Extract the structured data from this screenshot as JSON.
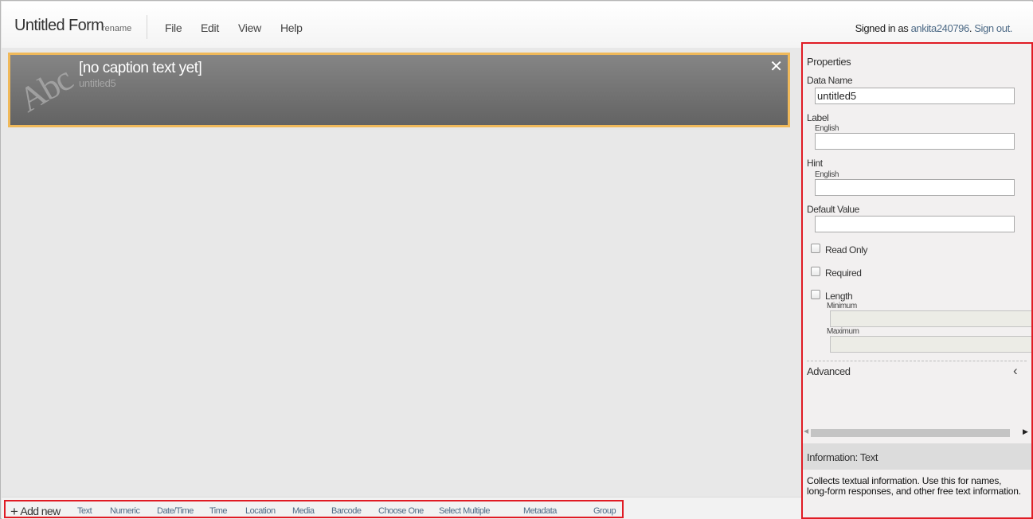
{
  "header": {
    "form_title": "Untitled Form",
    "rename_label": "rename",
    "menu": [
      "File",
      "Edit",
      "View",
      "Help"
    ],
    "signin_prefix": "Signed in as",
    "username": "ankita240796",
    "signout_label": "Sign out."
  },
  "workspace": {
    "control": {
      "caption": "[no caption text yet]",
      "data_name": "untitled5",
      "close_glyph": "✕",
      "icon_text": "Abc"
    }
  },
  "toolbar": {
    "add_new_label": "Add new",
    "items": [
      "Text",
      "Numeric",
      "Date/Time",
      "Time",
      "Location",
      "Media",
      "Barcode",
      "Choose One",
      "Select Multiple",
      "Metadata",
      "Group"
    ]
  },
  "properties": {
    "title": "Properties",
    "data_name_label": "Data Name",
    "data_name_value": "untitled5",
    "label_label": "Label",
    "label_lang": "English",
    "hint_label": "Hint",
    "hint_lang": "English",
    "default_value_label": "Default Value",
    "read_only_label": "Read Only",
    "required_label": "Required",
    "length_label": "Length",
    "minimum_label": "Minimum",
    "maximum_label": "Maximum",
    "advanced_label": "Advanced"
  },
  "info": {
    "title": "Information: Text",
    "body": "Collects textual information. Use this for names, long-form responses, and other free text information."
  },
  "colors": {
    "highlight_border": "#e01b24",
    "selected_control_border": "#f0b95a",
    "link": "#4d6a86"
  }
}
